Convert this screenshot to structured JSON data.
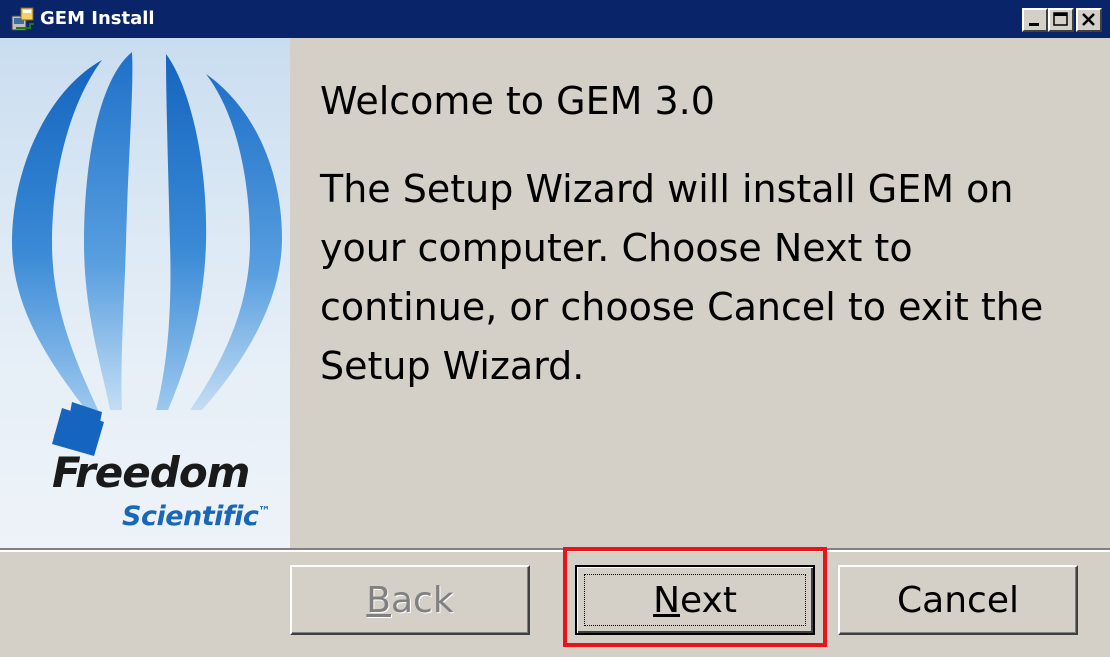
{
  "window": {
    "title": "GEM Install"
  },
  "content": {
    "welcome_title": "Welcome to GEM 3.0",
    "description": "The Setup Wizard will install GEM on your computer. Choose Next to continue, or choose Cancel to exit the Setup Wizard."
  },
  "branding": {
    "logo_line1": "Freedom",
    "logo_line2": "Scientific",
    "logo_mark": "™"
  },
  "buttons": {
    "back": {
      "mnemonic": "B",
      "rest": "ack",
      "enabled": false
    },
    "next": {
      "mnemonic": "N",
      "rest": "ext",
      "enabled": true,
      "focused": true
    },
    "cancel": {
      "label": "Cancel",
      "enabled": true
    }
  },
  "icons": {
    "title_icon": "installer-icon",
    "minimize": "minimize-icon",
    "maximize": "maximize-icon",
    "close": "close-icon",
    "banner": "hot-air-balloon-icon"
  },
  "colors": {
    "titlebar": "#0a246a",
    "dialog_bg": "#d4d0c8",
    "highlight": "#e8141c",
    "logo_blue": "#1a67b8"
  }
}
